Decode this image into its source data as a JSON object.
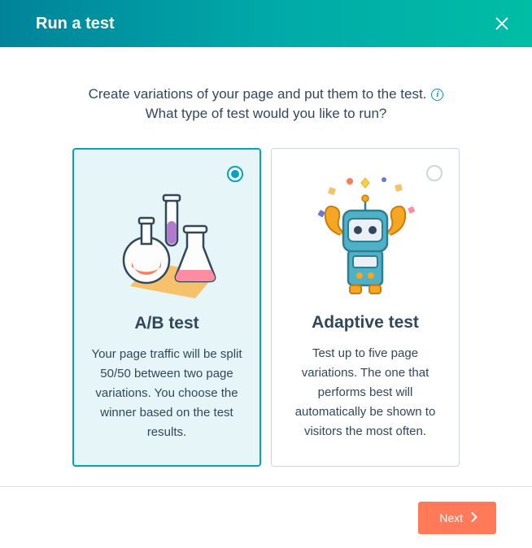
{
  "header": {
    "title": "Run a test"
  },
  "intro": {
    "line1": "Create variations of your page and put them to the test.",
    "info_icon": "info-icon",
    "line2": "What type of test would you like to run?"
  },
  "cards": [
    {
      "id": "ab",
      "title": "A/B test",
      "description": "Your page traffic will be split 50/50 between two page variations. You choose the winner based on the test results.",
      "selected": true,
      "image": "flasks"
    },
    {
      "id": "adaptive",
      "title": "Adaptive test",
      "description": "Test up to five page variations. The one that performs best will automatically be shown to visitors the most often.",
      "selected": false,
      "image": "robot"
    }
  ],
  "footer": {
    "next_label": "Next"
  }
}
